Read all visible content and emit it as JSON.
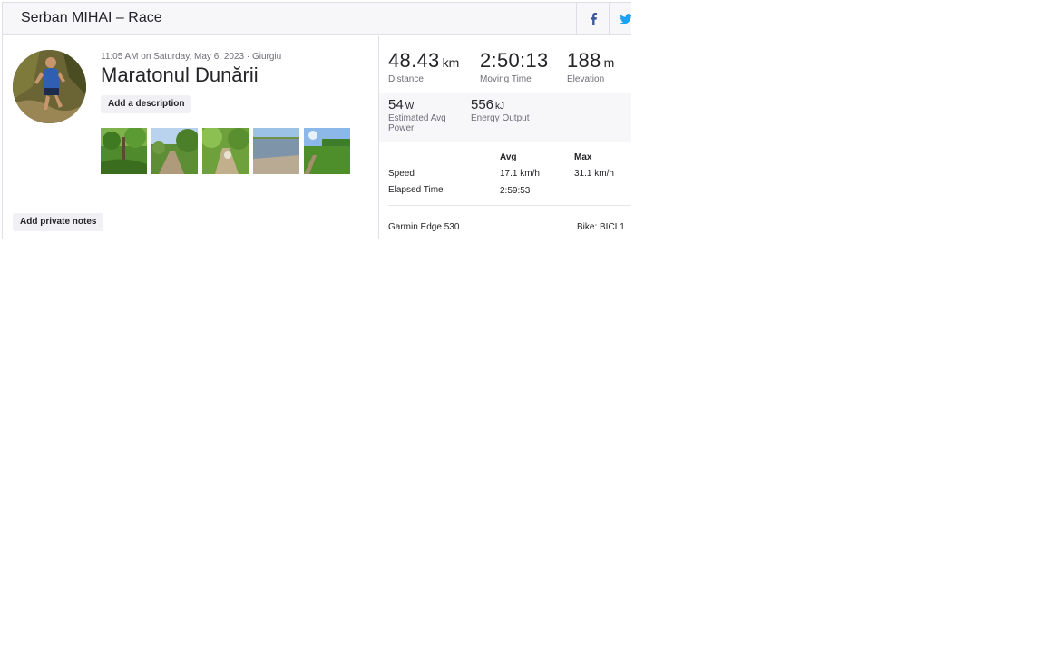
{
  "header": {
    "title": "Serban MIHAI – Race",
    "share": [
      {
        "icon": "facebook-icon",
        "color": "#3b5998"
      },
      {
        "icon": "twitter-icon",
        "color": "#1da1f2"
      }
    ]
  },
  "activity": {
    "meta": "11:05 AM on Saturday, May 6, 2023 · Giurgiu",
    "title": "Maratonul Dunării",
    "add_description_label": "Add a description",
    "add_private_notes_label": "Add private notes",
    "photos": [
      "forest-trail-photo",
      "dirt-path-by-trees-photo",
      "leafy-trail-photo",
      "river-view-photo",
      "riverside-field-photo"
    ]
  },
  "stats": {
    "distance": {
      "value": "48.43",
      "unit": "km",
      "label": "Distance"
    },
    "moving_time": {
      "value": "2:50:13",
      "label": "Moving Time"
    },
    "elevation": {
      "value": "188",
      "unit": "m",
      "label": "Elevation"
    },
    "avg_power": {
      "value": "54",
      "unit": "W",
      "label": "Estimated Avg Power"
    },
    "energy": {
      "value": "556",
      "unit": "kJ",
      "label": "Energy Output"
    }
  },
  "details": {
    "col_avg": "Avg",
    "col_max": "Max",
    "rows": [
      {
        "label": "Speed",
        "avg": "17.1 km/h",
        "max": "31.1 km/h"
      },
      {
        "label": "Elapsed Time",
        "avg": "2:59:53",
        "max": ""
      }
    ],
    "device": "Garmin Edge 530",
    "bike": "Bike: BICI 1"
  }
}
